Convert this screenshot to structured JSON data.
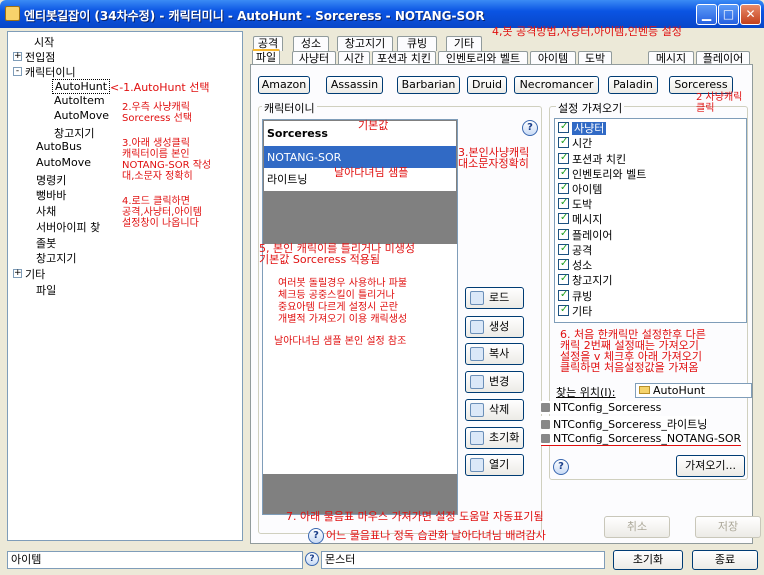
{
  "window": {
    "title": "엔티봇길잡이 (34차수정) - 캐릭터미니 - AutoHunt - Sorceress - NOTANG-SOR",
    "minimize_glyph": "▁",
    "maximize_glyph": "□",
    "close_glyph": "✕"
  },
  "tree": {
    "items": [
      {
        "label": "시작"
      },
      {
        "label": "전입점",
        "toggle": "+"
      },
      {
        "label": "캐릭터이니",
        "toggle": "-"
      },
      {
        "label": "AutoHunt"
      },
      {
        "label": "AutoItem"
      },
      {
        "label": "AutoMove"
      },
      {
        "label": "창고지기"
      },
      {
        "label": "AutoBus"
      },
      {
        "label": "AutoMove"
      },
      {
        "label": "명령키"
      },
      {
        "label": "뻥바바"
      },
      {
        "label": "사채"
      },
      {
        "label": "서버아이피 찾"
      },
      {
        "label": "졸봇"
      },
      {
        "label": "창고지기"
      },
      {
        "label": "기타",
        "toggle": "+"
      },
      {
        "label": "파일"
      }
    ]
  },
  "annotations": {
    "n1": "<-1.AutoHunt 선택",
    "n2": "2.우측 사냥캐릭\nSorceress 선택",
    "n2b": "2 사냥캐릭\n클릭",
    "n3": "3.아래 생성클릭\n캐릭터이름 본인\nNOTANG-SOR 작성\n대,소문자 정확히",
    "n3b": "3.본인사냥캐릭\n대소문자정확히",
    "n4": "4,봇 공격방법,사냥터,아이템,인벤등 설정",
    "n4b": "4.로드 클릭하면\n공격,사냥터,아이템\n설정창이 나옵니다",
    "n5": "5, 본인 캐릭이를 틀리거나 미생성\n기본값 Sorceress 적용됨",
    "n5b": "여러봇 돌릴경우 사용하나 파불\n체크등 공중스킬이 틀리거나\n중요아템 다르게 설정시 곤란\n개별적 가져오기 이용 캐릭생성",
    "n5c": "날아다녀님 샘플 본인 설정 참조",
    "n6": "6. 처음 한캐릭만 설정한후 다른\n캐릭 2번째 설정때는 가져오기\n설정을 v 체크후 아래 가져오기\n클릭하면 처음설정값을 가져옴",
    "n7": "7. 아래 물음표 마우스 가져가면 설정 도움말 자동표기됨",
    "n7b": "어느 물음표나 정독 습관화 날아다녀님 배려감사",
    "default_label": "기본값",
    "sample_label": "날아다녀님 샘플"
  },
  "tabs_top": [
    "공격",
    "성소",
    "창고지기",
    "큐빙",
    "기타"
  ],
  "tabs_bottom": [
    "파일",
    "사냥터",
    "시간",
    "포션과 치킨",
    "인벤토리와 벨트",
    "아이템",
    "도박",
    "메시지",
    "플레이어"
  ],
  "classes": [
    "Amazon",
    "Assassin",
    "Barbarian",
    "Druid",
    "Necromancer",
    "Paladin",
    "Sorceress"
  ],
  "character_group": "캐릭터이니",
  "characters": [
    "Sorceress",
    "NOTANG-SOR",
    "라이트닝"
  ],
  "buttons": [
    "로드",
    "생성",
    "복사",
    "변경",
    "삭제",
    "초기화",
    "열기"
  ],
  "settings_group": "설정 가져오기",
  "settings": [
    "사냥터",
    "시간",
    "포션과 치킨",
    "인벤토리와 벨트",
    "아이템",
    "도박",
    "메시지",
    "플레이어",
    "공격",
    "성소",
    "창고지기",
    "큐빙",
    "기타"
  ],
  "find_location": {
    "label": "찾는 위치(I):",
    "folder": "AutoHunt"
  },
  "config_files": [
    "NTConfig_Sorceress",
    "NTConfig_Sorceress_라이트닝",
    "NTConfig_Sorceress_NOTANG-SOR"
  ],
  "import_button": "가져오기...",
  "help_glyph": "?",
  "footer": {
    "cancel": "취소",
    "save": "저장",
    "reset": "초기화",
    "exit": "종료",
    "status_left": "아이템",
    "status_mid": "몬스터"
  }
}
